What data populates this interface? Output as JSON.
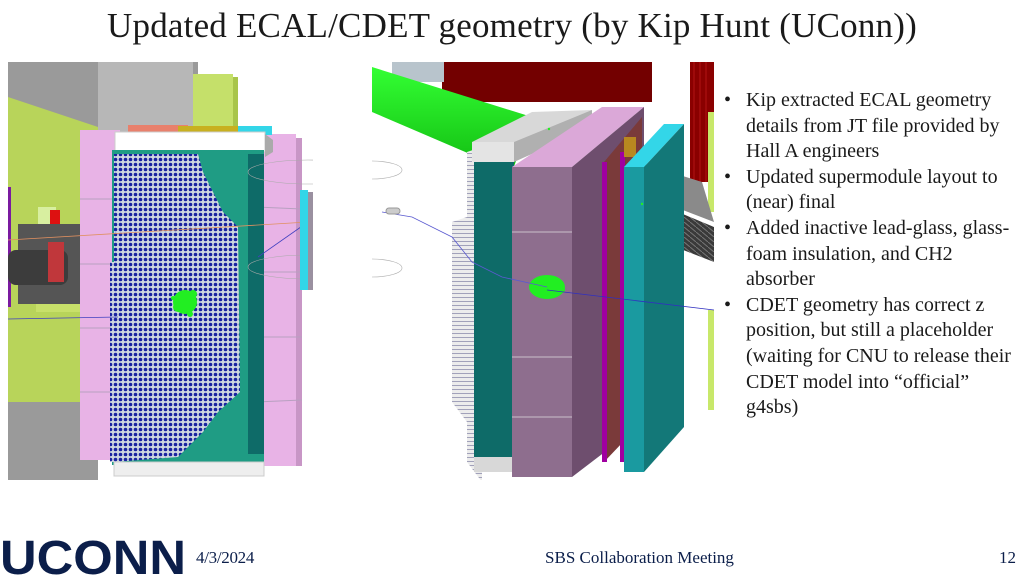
{
  "slide": {
    "title": "Updated ECAL/CDET geometry (by Kip Hunt (UConn))",
    "bullets": [
      "Kip extracted ECAL geometry details from JT file provided by Hall A engineers",
      "Updated supermodule layout to (near) final",
      "Added inactive lead-glass, glass-foam insulation, and CH2 absorber",
      "CDET geometry has correct z position, but still a placeholder (waiting for CNU to release their CDET model into “official” g4sbs)"
    ],
    "bullet_glyph": "•"
  },
  "figures": {
    "left": {
      "description": "ECAL front view geometry rendering with module grid and green hit cluster"
    },
    "right": {
      "description": "ECAL/CDET side perspective geometry rendering with particle tracks"
    }
  },
  "colors": {
    "pink_frame": "#e8b3e6",
    "teal": "#1f9c84",
    "dark_teal": "#0e6b68",
    "module_blue": "#1a22a0",
    "hit_green": "#22ee22",
    "lime": "#c8e86a",
    "gray": "#a9a9a9",
    "cyan": "#33d6e8",
    "mauve": "#8e6e8e",
    "magenta": "#a000a0",
    "dark_red": "#7a0000",
    "uconn_navy": "#0b1e4a"
  },
  "footer": {
    "logo_text": "UCONN",
    "date": "4/3/2024",
    "meeting": "SBS Collaboration Meeting",
    "page_number": "12"
  }
}
